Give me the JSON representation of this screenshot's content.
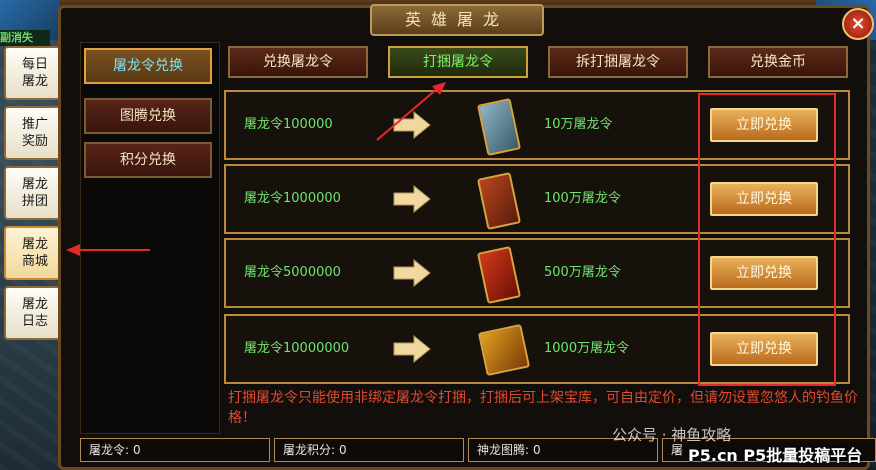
{
  "window": {
    "title": "英雄屠龙",
    "close_symbol": "×"
  },
  "top_left_label": "副消失",
  "side_tabs": [
    {
      "label": "每日屠龙"
    },
    {
      "label": "推广奖励"
    },
    {
      "label": "屠龙拼团"
    },
    {
      "label": "屠龙商城"
    },
    {
      "label": "屠龙日志"
    }
  ],
  "left_menu": [
    {
      "label": "屠龙令兑换"
    },
    {
      "label": "图腾兑换"
    },
    {
      "label": "积分兑换"
    }
  ],
  "top_tabs": [
    {
      "label": "兑换屠龙令"
    },
    {
      "label": "打捆屠龙令"
    },
    {
      "label": "拆打捆屠龙令"
    },
    {
      "label": "兑换金币"
    }
  ],
  "rows": [
    {
      "name": "屠龙令100000",
      "amount": "10万屠龙令",
      "button": "立即兑换",
      "icon": "token-bundle-icon"
    },
    {
      "name": "屠龙令1000000",
      "amount": "100万屠龙令",
      "button": "立即兑换",
      "icon": "token-bundle-icon"
    },
    {
      "name": "屠龙令5000000",
      "amount": "500万屠龙令",
      "button": "立即兑换",
      "icon": "token-bundle-icon"
    },
    {
      "name": "屠龙令10000000",
      "amount": "1000万屠龙令",
      "button": "立即兑换",
      "icon": "token-bundle-icon"
    }
  ],
  "note": "打捆屠龙令只能使用非绑定屠龙令打捆，打捆后可上架宝库，可自由定价，但请勿设置忽悠人的钓鱼价格！",
  "bottom": [
    {
      "label": "屠龙令:",
      "value": "0"
    },
    {
      "label": "屠龙积分:",
      "value": "0"
    },
    {
      "label": "神龙图腾:",
      "value": "0"
    },
    {
      "label": "屠",
      "value": ""
    }
  ],
  "watermark": {
    "line1": "公众号 · 神鱼攻略",
    "line2": "P5.cn P5批量投稿平台"
  },
  "colors": {
    "accent_green": "#6ee46e",
    "note_red": "#e04a30",
    "highlight_red": "#e22a2a",
    "button_orange": "#d08a30"
  }
}
